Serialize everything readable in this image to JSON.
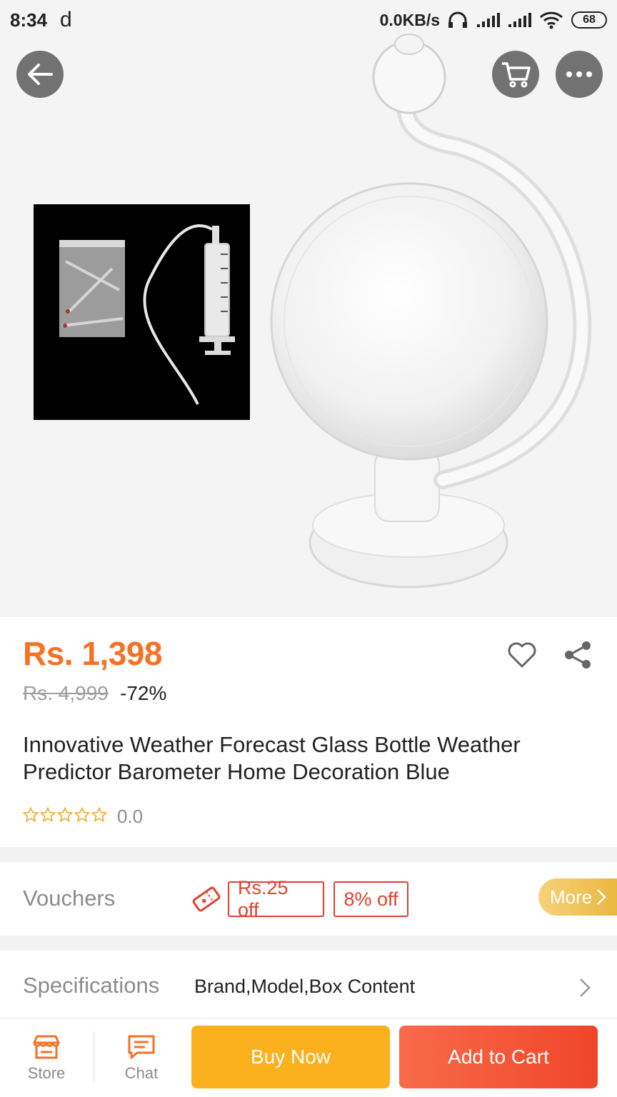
{
  "status_bar": {
    "time": "8:34",
    "notif": "d",
    "speed": "0.0KB/s",
    "battery": "68"
  },
  "product": {
    "price": "Rs. 1,398",
    "original_price": "Rs. 4,999",
    "discount": "-72%",
    "title": "Innovative Weather Forecast Glass Bottle Weather Predictor Barometer Home Decoration Blue",
    "rating": "0.0",
    "stars_filled": 0,
    "stars_total": 5
  },
  "vouchers": {
    "label": "Vouchers",
    "items": [
      "Rs.25 off",
      "8% off"
    ],
    "more_label": "More"
  },
  "specifications": {
    "label": "Specifications",
    "value": "Brand,Model,Box Content"
  },
  "bottom_bar": {
    "store_label": "Store",
    "chat_label": "Chat",
    "buy_now_label": "Buy Now",
    "add_to_cart_label": "Add to Cart"
  },
  "colors": {
    "price": "#f57224",
    "voucher": "#e0422e",
    "buy_now": "#fbb01e",
    "add_to_cart": "#f0462a",
    "more_pill": "#e8b53c"
  },
  "icons": [
    "back-arrow-icon",
    "cart-icon",
    "more-icon",
    "heart-icon",
    "share-icon",
    "voucher-ticket-icon",
    "chevron-right-icon",
    "store-icon",
    "chat-icon",
    "star-icon",
    "headphones-icon",
    "signal-icon",
    "wifi-icon"
  ]
}
